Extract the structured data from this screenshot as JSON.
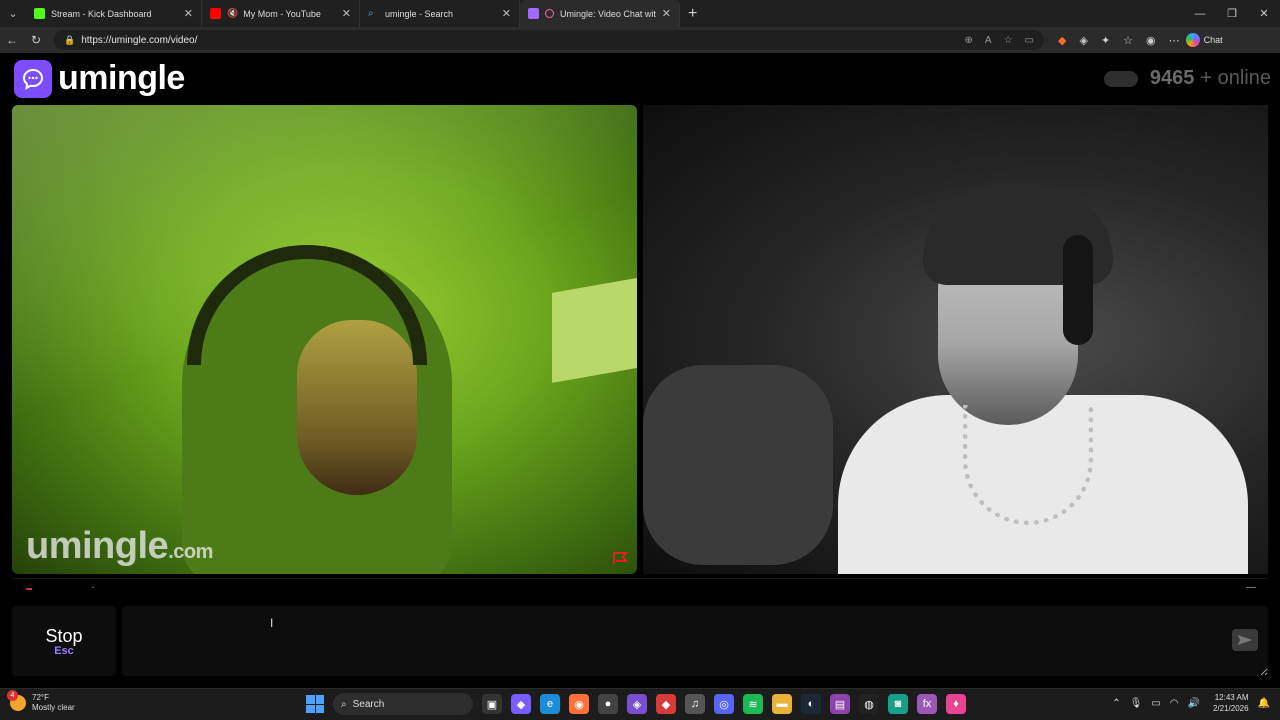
{
  "browser": {
    "tabs": [
      {
        "label": "Stream - Kick Dashboard",
        "favicon_color": "#53fc18"
      },
      {
        "label": "My Mom - YouTube",
        "favicon_color": "#ff0000"
      },
      {
        "label": "umingle - Search",
        "favicon_color": "#4aa3ff"
      },
      {
        "label": "Umingle: Video Chat with Stra",
        "favicon_color": "#a26bff"
      }
    ],
    "url": "https://umingle.com/video/",
    "chat_label": "Chat"
  },
  "page": {
    "brand": "umingle",
    "online_count": "9465",
    "online_suffix": "+ online",
    "watermark_main": "umingle",
    "watermark_tld": ".com",
    "stop_label": "Stop",
    "stop_key": "Esc",
    "chat_placeholder": "",
    "accent_color": "#7c4dff"
  },
  "taskbar": {
    "weather_badge": "4",
    "weather_temp": "72°F",
    "weather_desc": "Mostly clear",
    "search_label": "Search",
    "time": "12:43 AM",
    "date": "2/21/2026"
  }
}
